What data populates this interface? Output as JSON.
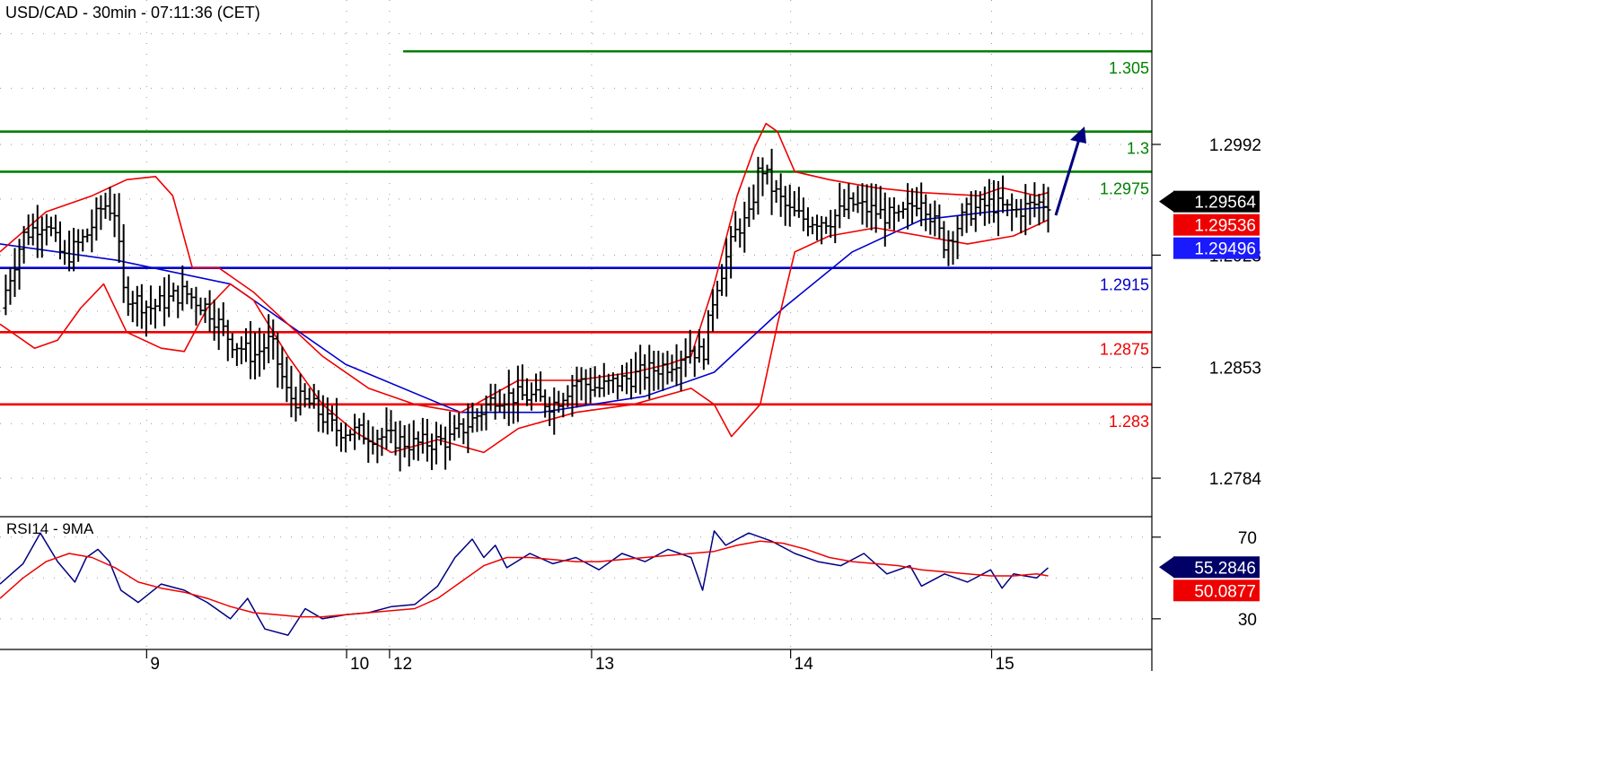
{
  "chart_data": [
    {
      "type": "ohlc",
      "title": "USD/CAD - 30min - 07:11:36 (CET)",
      "ylim": [
        1.276,
        1.3082
      ],
      "y_ticks": [
        {
          "value": 1.2992,
          "label": "1.2992"
        },
        {
          "value": 1.2923,
          "label": "1.2923"
        },
        {
          "value": 1.2853,
          "label": "1.2853"
        },
        {
          "value": 1.2784,
          "label": "1.2784"
        }
      ],
      "x_ticks": [
        {
          "pos": 0.1273,
          "label": "9"
        },
        {
          "pos": 0.3009,
          "label": "10"
        },
        {
          "pos": 0.3382,
          "label": "12"
        },
        {
          "pos": 0.5136,
          "label": "13"
        },
        {
          "pos": 0.6864,
          "label": "14"
        },
        {
          "pos": 0.8609,
          "label": "15"
        }
      ],
      "levels": [
        {
          "value": 1.305,
          "label": "1.305",
          "color": "#008000",
          "start": 0.35
        },
        {
          "value": 1.3,
          "label": "1.3",
          "color": "#008000",
          "start": 0
        },
        {
          "value": 1.2975,
          "label": "1.2975",
          "color": "#008000",
          "start": 0
        },
        {
          "value": 1.2915,
          "label": "1.2915",
          "color": "#0000cc",
          "start": 0
        },
        {
          "value": 1.2875,
          "label": "1.2875",
          "color": "#ee0000",
          "start": 0
        },
        {
          "value": 1.283,
          "label": "1.283",
          "color": "#ee0000",
          "start": 0
        }
      ],
      "price_tags": [
        {
          "value": 1.29564,
          "label": "1.29564",
          "bg": "#000000",
          "fg": "#ffffff"
        },
        {
          "value": 1.29536,
          "label": "1.29536",
          "bg": "#ee0000",
          "fg": "#ffffff"
        },
        {
          "value": 1.29496,
          "label": "1.29496",
          "bg": "#1a1aff",
          "fg": "#ffffff"
        }
      ],
      "price_keypoints": [
        [
          0.0,
          1.289
        ],
        [
          0.02,
          1.2935
        ],
        [
          0.04,
          1.2945
        ],
        [
          0.055,
          1.292
        ],
        [
          0.075,
          1.2935
        ],
        [
          0.09,
          1.2955
        ],
        [
          0.1,
          1.295
        ],
        [
          0.107,
          1.29
        ],
        [
          0.13,
          1.289
        ],
        [
          0.16,
          1.29
        ],
        [
          0.18,
          1.289
        ],
        [
          0.2,
          1.287
        ],
        [
          0.22,
          1.286
        ],
        [
          0.235,
          1.287
        ],
        [
          0.25,
          1.2835
        ],
        [
          0.27,
          1.283
        ],
        [
          0.29,
          1.2815
        ],
        [
          0.33,
          1.281
        ],
        [
          0.36,
          1.2805
        ],
        [
          0.39,
          1.2808
        ],
        [
          0.41,
          1.282
        ],
        [
          0.43,
          1.2835
        ],
        [
          0.46,
          1.2835
        ],
        [
          0.48,
          1.283
        ],
        [
          0.5,
          1.2845
        ],
        [
          0.52,
          1.284
        ],
        [
          0.54,
          1.2845
        ],
        [
          0.56,
          1.285
        ],
        [
          0.58,
          1.2855
        ],
        [
          0.6,
          1.2865
        ],
        [
          0.61,
          1.286
        ],
        [
          0.62,
          1.29
        ],
        [
          0.64,
          1.294
        ],
        [
          0.65,
          1.2945
        ],
        [
          0.66,
          1.298
        ],
        [
          0.67,
          1.2965
        ],
        [
          0.685,
          1.295
        ],
        [
          0.7,
          1.2945
        ],
        [
          0.72,
          1.2945
        ],
        [
          0.74,
          1.2955
        ],
        [
          0.76,
          1.295
        ],
        [
          0.78,
          1.2945
        ],
        [
          0.8,
          1.296
        ],
        [
          0.81,
          1.2945
        ],
        [
          0.82,
          1.293
        ],
        [
          0.84,
          1.295
        ],
        [
          0.86,
          1.2955
        ],
        [
          0.88,
          1.295
        ],
        [
          0.9,
          1.2955
        ],
        [
          0.91,
          1.2956
        ]
      ],
      "series": [
        {
          "name": "middle",
          "color": "#0000cc",
          "values": [
            [
              0.0,
              1.293
            ],
            [
              0.1,
              1.292
            ],
            [
              0.2,
              1.2905
            ],
            [
              0.3,
              1.2855
            ],
            [
              0.4,
              1.2825
            ],
            [
              0.47,
              1.2825
            ],
            [
              0.56,
              1.2835
            ],
            [
              0.62,
              1.285
            ],
            [
              0.68,
              1.289
            ],
            [
              0.74,
              1.2925
            ],
            [
              0.8,
              1.2945
            ],
            [
              0.86,
              1.295
            ],
            [
              0.91,
              1.2953
            ]
          ]
        },
        {
          "name": "upper",
          "color": "#ee0000",
          "values": [
            [
              0.0,
              1.2925
            ],
            [
              0.04,
              1.295
            ],
            [
              0.08,
              1.296
            ],
            [
              0.11,
              1.297
            ],
            [
              0.135,
              1.2972
            ],
            [
              0.15,
              1.296
            ],
            [
              0.167,
              1.2915
            ],
            [
              0.19,
              1.2915
            ],
            [
              0.22,
              1.29
            ],
            [
              0.25,
              1.288
            ],
            [
              0.28,
              1.286
            ],
            [
              0.32,
              1.284
            ],
            [
              0.36,
              1.283
            ],
            [
              0.4,
              1.2825
            ],
            [
              0.45,
              1.2845
            ],
            [
              0.5,
              1.2845
            ],
            [
              0.55,
              1.285
            ],
            [
              0.58,
              1.2855
            ],
            [
              0.6,
              1.286
            ],
            [
              0.62,
              1.2905
            ],
            [
              0.64,
              1.296
            ],
            [
              0.655,
              1.299
            ],
            [
              0.665,
              1.3005
            ],
            [
              0.675,
              1.3
            ],
            [
              0.69,
              1.2975
            ],
            [
              0.72,
              1.297
            ],
            [
              0.76,
              1.2965
            ],
            [
              0.8,
              1.2962
            ],
            [
              0.85,
              1.296
            ],
            [
              0.87,
              1.2965
            ],
            [
              0.9,
              1.296
            ],
            [
              0.91,
              1.2962
            ]
          ]
        },
        {
          "name": "lower",
          "color": "#ee0000",
          "values": [
            [
              0.0,
              1.288
            ],
            [
              0.03,
              1.2865
            ],
            [
              0.05,
              1.287
            ],
            [
              0.07,
              1.289
            ],
            [
              0.09,
              1.2905
            ],
            [
              0.11,
              1.2875
            ],
            [
              0.14,
              1.2865
            ],
            [
              0.16,
              1.2863
            ],
            [
              0.18,
              1.289
            ],
            [
              0.2,
              1.2905
            ],
            [
              0.22,
              1.2895
            ],
            [
              0.25,
              1.286
            ],
            [
              0.28,
              1.283
            ],
            [
              0.31,
              1.2812
            ],
            [
              0.34,
              1.28
            ],
            [
              0.38,
              1.2808
            ],
            [
              0.42,
              1.28
            ],
            [
              0.45,
              1.2815
            ],
            [
              0.5,
              1.2825
            ],
            [
              0.55,
              1.283
            ],
            [
              0.6,
              1.284
            ],
            [
              0.62,
              1.283
            ],
            [
              0.635,
              1.281
            ],
            [
              0.66,
              1.283
            ],
            [
              0.675,
              1.288
            ],
            [
              0.69,
              1.2925
            ],
            [
              0.72,
              1.2935
            ],
            [
              0.76,
              1.294
            ],
            [
              0.8,
              1.2935
            ],
            [
              0.84,
              1.293
            ],
            [
              0.88,
              1.2935
            ],
            [
              0.91,
              1.2945
            ]
          ]
        }
      ]
    },
    {
      "type": "line",
      "title": "RSI14 - 9MA",
      "ylim": [
        15,
        80
      ],
      "y_ticks": [
        {
          "value": 70,
          "label": "70"
        },
        {
          "value": 30,
          "label": "30"
        }
      ],
      "price_tags": [
        {
          "value": 55.2846,
          "label": "55.2846",
          "bg": "#000066",
          "fg": "#ffffff"
        },
        {
          "value": 50.0877,
          "label": "50.0877",
          "bg": "#ee0000",
          "fg": "#ffffff"
        }
      ],
      "series": [
        {
          "name": "RSI14",
          "color": "#000080",
          "values": [
            [
              0.0,
              47
            ],
            [
              0.02,
              57
            ],
            [
              0.035,
              72
            ],
            [
              0.05,
              58
            ],
            [
              0.065,
              48
            ],
            [
              0.075,
              60
            ],
            [
              0.085,
              64
            ],
            [
              0.095,
              58
            ],
            [
              0.105,
              44
            ],
            [
              0.12,
              38
            ],
            [
              0.14,
              47
            ],
            [
              0.16,
              44
            ],
            [
              0.18,
              38
            ],
            [
              0.2,
              30
            ],
            [
              0.215,
              40
            ],
            [
              0.23,
              25
            ],
            [
              0.25,
              22
            ],
            [
              0.265,
              35
            ],
            [
              0.28,
              30
            ],
            [
              0.3,
              32
            ],
            [
              0.32,
              33
            ],
            [
              0.34,
              36
            ],
            [
              0.36,
              37
            ],
            [
              0.38,
              46
            ],
            [
              0.395,
              60
            ],
            [
              0.41,
              69
            ],
            [
              0.42,
              60
            ],
            [
              0.43,
              66
            ],
            [
              0.44,
              55
            ],
            [
              0.46,
              62
            ],
            [
              0.48,
              57
            ],
            [
              0.5,
              60
            ],
            [
              0.52,
              54
            ],
            [
              0.54,
              62
            ],
            [
              0.56,
              58
            ],
            [
              0.58,
              64
            ],
            [
              0.6,
              60
            ],
            [
              0.61,
              44
            ],
            [
              0.62,
              73
            ],
            [
              0.63,
              66
            ],
            [
              0.65,
              72
            ],
            [
              0.67,
              68
            ],
            [
              0.69,
              62
            ],
            [
              0.71,
              58
            ],
            [
              0.73,
              56
            ],
            [
              0.75,
              62
            ],
            [
              0.77,
              52
            ],
            [
              0.79,
              56
            ],
            [
              0.8,
              46
            ],
            [
              0.82,
              52
            ],
            [
              0.84,
              48
            ],
            [
              0.86,
              54
            ],
            [
              0.87,
              45
            ],
            [
              0.88,
              52
            ],
            [
              0.9,
              50
            ],
            [
              0.91,
              55
            ]
          ]
        },
        {
          "name": "9MA",
          "color": "#ee0000",
          "values": [
            [
              0.0,
              40
            ],
            [
              0.02,
              50
            ],
            [
              0.04,
              58
            ],
            [
              0.06,
              62
            ],
            [
              0.08,
              60
            ],
            [
              0.1,
              55
            ],
            [
              0.12,
              48
            ],
            [
              0.14,
              45
            ],
            [
              0.16,
              43
            ],
            [
              0.18,
              40
            ],
            [
              0.2,
              36
            ],
            [
              0.22,
              33
            ],
            [
              0.24,
              32
            ],
            [
              0.26,
              31
            ],
            [
              0.28,
              31
            ],
            [
              0.3,
              32
            ],
            [
              0.32,
              33
            ],
            [
              0.34,
              34
            ],
            [
              0.36,
              35
            ],
            [
              0.38,
              40
            ],
            [
              0.4,
              48
            ],
            [
              0.42,
              56
            ],
            [
              0.44,
              60
            ],
            [
              0.46,
              60
            ],
            [
              0.48,
              59
            ],
            [
              0.5,
              58
            ],
            [
              0.52,
              58
            ],
            [
              0.54,
              59
            ],
            [
              0.56,
              60
            ],
            [
              0.58,
              61
            ],
            [
              0.6,
              62
            ],
            [
              0.62,
              63
            ],
            [
              0.64,
              66
            ],
            [
              0.66,
              68
            ],
            [
              0.68,
              67
            ],
            [
              0.7,
              64
            ],
            [
              0.72,
              60
            ],
            [
              0.74,
              58
            ],
            [
              0.76,
              57
            ],
            [
              0.78,
              56
            ],
            [
              0.8,
              54
            ],
            [
              0.82,
              53
            ],
            [
              0.84,
              52
            ],
            [
              0.86,
              51
            ],
            [
              0.88,
              51
            ],
            [
              0.9,
              52
            ],
            [
              0.91,
              51
            ]
          ]
        }
      ]
    }
  ]
}
